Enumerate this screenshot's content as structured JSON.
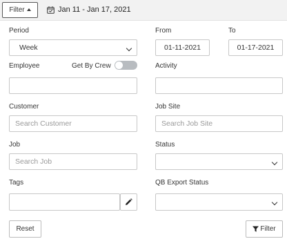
{
  "toolbar": {
    "filter_label": "Filter",
    "date_range": "Jan 11 - Jan 17, 2021"
  },
  "period": {
    "label": "Period",
    "value": "Week"
  },
  "from": {
    "label": "From",
    "value": "01-11-2021"
  },
  "to": {
    "label": "To",
    "value": "01-17-2021"
  },
  "employee": {
    "label": "Employee",
    "value": ""
  },
  "get_by_crew": {
    "label": "Get By Crew",
    "enabled": false
  },
  "activity": {
    "label": "Activity",
    "value": ""
  },
  "customer": {
    "label": "Customer",
    "placeholder": "Search Customer"
  },
  "job_site": {
    "label": "Job Site",
    "placeholder": "Search Job Site"
  },
  "job": {
    "label": "Job",
    "placeholder": "Search Job"
  },
  "status": {
    "label": "Status",
    "value": ""
  },
  "tags": {
    "label": "Tags",
    "value": ""
  },
  "qb_export_status": {
    "label": "QB Export Status",
    "value": ""
  },
  "actions": {
    "reset_label": "Reset",
    "filter_label": "Filter"
  },
  "icons": {
    "calendar": "calendar-icon",
    "pencil": "pencil-icon",
    "funnel": "funnel-icon",
    "chevron": "chevron-down-icon",
    "caret": "caret-up-icon"
  },
  "colors": {
    "toolbar_bg": "#f2f2f2",
    "toggle_off": "#b8bcc0"
  }
}
